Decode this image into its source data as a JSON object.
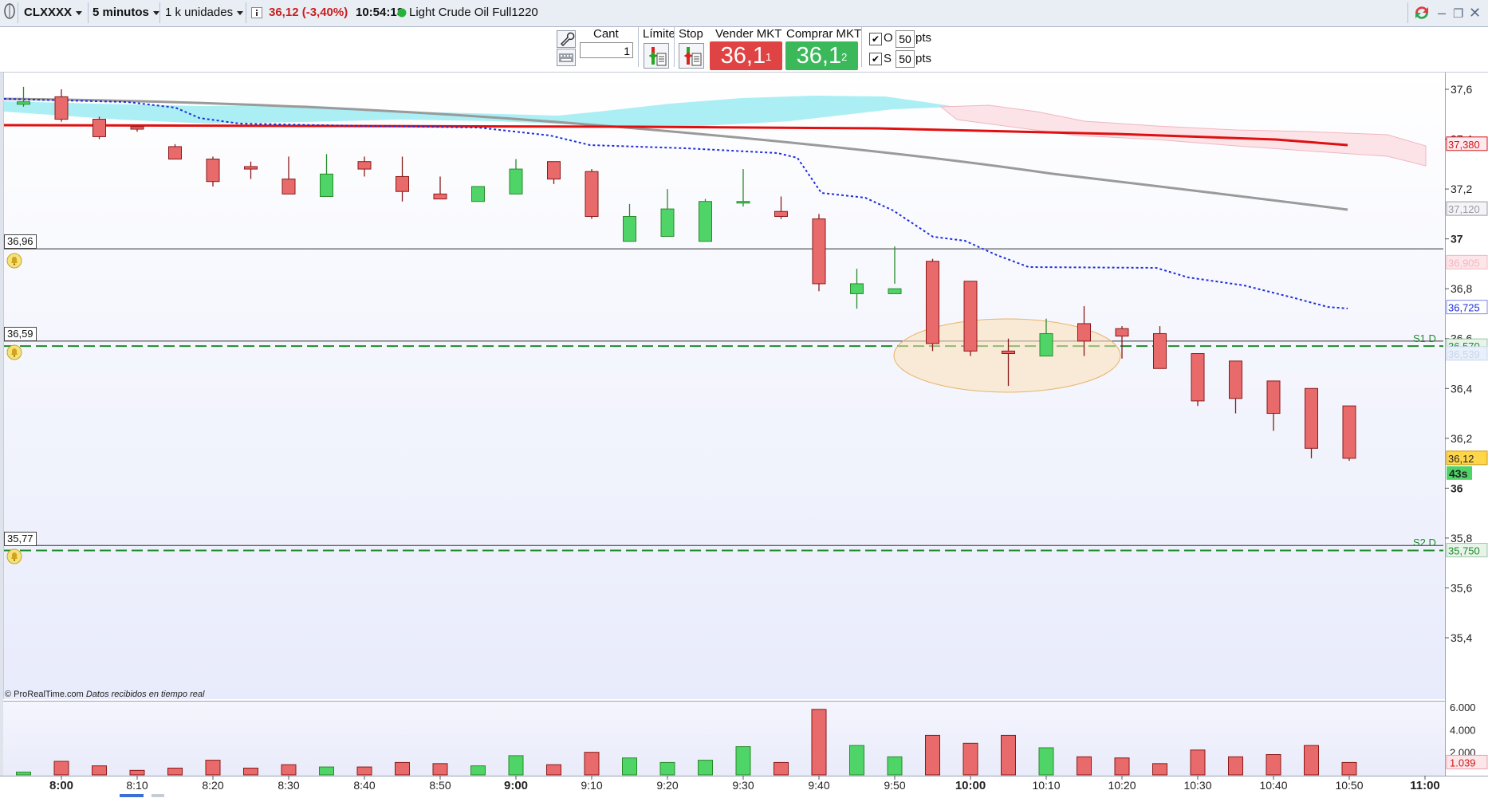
{
  "topbar": {
    "symbol": "CLXXXX",
    "timeframe": "5 minutos",
    "units": "1 k unidades",
    "price_change": "36,12 (-3,40%)",
    "time": "10:54:13",
    "instrument": "Light Crude Oil Full1220"
  },
  "orderbar": {
    "cant_label": "Cant",
    "cant_value": "1",
    "limit_label": "Límite",
    "stop_label": "Stop",
    "sell_label": "Vender MKT",
    "sell_main": "36,1",
    "sell_sup": "1",
    "buy_label": "Comprar MKT",
    "buy_main": "36,1",
    "buy_sup": "2",
    "o_label": "O",
    "o_value": "50",
    "s_label": "S",
    "s_value": "50",
    "pts_label": "pts"
  },
  "chart": {
    "copyright": "© ProRealTime.com",
    "realtime_note": "Datos recibidos en tiempo real",
    "alert_levels": [
      "36,96",
      "36,59",
      "35,77"
    ],
    "s1_label": "S1 D",
    "s2_label": "S2 D",
    "y_ticks": [
      "37,6",
      "37,4",
      "37,2",
      "37",
      "36,8",
      "36,6",
      "36,4",
      "36,2",
      "36",
      "35,8",
      "35,6",
      "35,4"
    ],
    "price_tags": {
      "red_ma": "37,380",
      "gray_ma": "37,120",
      "pink": "36,905",
      "blue": "36,725",
      "s1": "36,570",
      "hidden": "36,539",
      "current": "36,12",
      "countdown": "43s",
      "s2": "35,750"
    },
    "volume_ticks": [
      "6.000",
      "4.000",
      "2.000"
    ],
    "volume_tag": "1.039",
    "x_ticks": [
      "8:00",
      "8:10",
      "8:20",
      "8:30",
      "8:40",
      "8:50",
      "9:00",
      "9:10",
      "9:20",
      "9:30",
      "9:40",
      "9:50",
      "10:00",
      "10:10",
      "10:20",
      "10:30",
      "10:40",
      "10:50",
      "11:00"
    ],
    "x_bold": [
      "8:00",
      "9:00",
      "10:00",
      "11:00"
    ],
    "colors": {
      "up": "#4fd468",
      "down": "#e86a6a",
      "ma_red": "#e01010",
      "ma_gray": "#9a9a9a",
      "tenkan_blue": "#1f2fd9",
      "cloud": "#8fe9f2",
      "support": "#1c8a2a"
    }
  },
  "chart_data": {
    "type": "candlestick",
    "x": [
      "7:55",
      "8:00",
      "8:05",
      "8:10",
      "8:15",
      "8:20",
      "8:25",
      "8:30",
      "8:35",
      "8:40",
      "8:45",
      "8:50",
      "8:55",
      "9:00",
      "9:05",
      "9:10",
      "9:15",
      "9:20",
      "9:25",
      "9:30",
      "9:35",
      "9:40",
      "9:45",
      "9:50",
      "9:55",
      "10:00",
      "10:05",
      "10:10",
      "10:15",
      "10:20",
      "10:25",
      "10:30",
      "10:35",
      "10:40",
      "10:45",
      "10:50"
    ],
    "open": [
      37.54,
      37.57,
      37.48,
      37.45,
      37.37,
      37.32,
      37.29,
      37.24,
      37.17,
      37.31,
      37.25,
      37.18,
      37.15,
      37.18,
      37.31,
      37.27,
      36.99,
      37.01,
      36.99,
      37.15,
      37.11,
      37.08,
      36.78,
      36.78,
      36.91,
      36.83,
      36.55,
      36.53,
      36.66,
      36.64,
      36.62,
      36.54,
      36.51,
      36.43,
      36.4,
      36.33
    ],
    "high": [
      37.61,
      37.6,
      37.49,
      37.45,
      37.38,
      37.33,
      37.31,
      37.33,
      37.34,
      37.33,
      37.33,
      37.25,
      37.21,
      37.32,
      37.31,
      37.28,
      37.14,
      37.2,
      37.16,
      37.28,
      37.17,
      37.1,
      36.88,
      36.97,
      36.92,
      36.65,
      36.6,
      36.68,
      36.73,
      36.65,
      36.65,
      36.54,
      36.49,
      36.42,
      36.32,
      36.21
    ],
    "low": [
      37.53,
      37.47,
      37.4,
      37.43,
      37.33,
      37.21,
      37.24,
      37.21,
      37.2,
      37.25,
      37.15,
      37.16,
      37.15,
      37.22,
      37.22,
      37.08,
      37.07,
      37.07,
      37.12,
      37.13,
      37.08,
      36.79,
      36.72,
      36.82,
      36.55,
      36.53,
      36.41,
      36.53,
      36.53,
      36.52,
      36.49,
      36.33,
      36.3,
      36.23,
      36.12,
      36.11
    ],
    "close": [
      37.55,
      37.48,
      37.41,
      37.44,
      37.32,
      37.23,
      37.28,
      37.18,
      37.26,
      37.28,
      37.19,
      37.16,
      37.21,
      37.28,
      37.24,
      37.09,
      37.09,
      37.12,
      37.15,
      37.15,
      37.09,
      36.82,
      36.82,
      36.8,
      36.58,
      36.55,
      36.54,
      36.62,
      36.59,
      36.61,
      36.48,
      36.35,
      36.36,
      36.3,
      36.16,
      36.12
    ],
    "volume": [
      250,
      1200,
      800,
      400,
      600,
      1300,
      600,
      900,
      700,
      700,
      1100,
      1000,
      800,
      1700,
      900,
      2000,
      1500,
      1100,
      1300,
      2500,
      1100,
      5800,
      2600,
      1600,
      3500,
      2800,
      3500,
      2400,
      1600,
      1500,
      1000,
      2200,
      1600,
      1800,
      2600,
      1100
    ],
    "ylim": [
      35.3,
      37.65
    ]
  }
}
